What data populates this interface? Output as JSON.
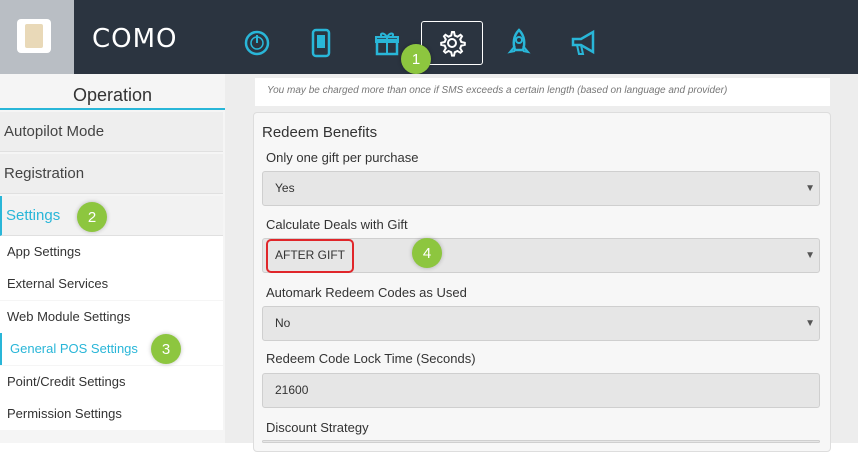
{
  "brand": "COMO",
  "nav": {
    "icons": [
      "dashboard-gauge-icon",
      "mobile-app-icon",
      "gift-icon",
      "gear-icon",
      "rocket-icon",
      "megaphone-icon"
    ],
    "active": "gear-icon"
  },
  "badges": {
    "b1": "1",
    "b2": "2",
    "b3": "3",
    "b4": "4"
  },
  "sidebar": {
    "header": "Operation",
    "main_items": [
      "Autopilot Mode",
      "Registration",
      "Settings"
    ],
    "sub_items": [
      "App Settings",
      "External Services",
      "Web Module Settings",
      "General POS Settings",
      "Point/Credit Settings",
      "Permission Settings"
    ]
  },
  "content": {
    "sms_note": "You may be charged more than once if SMS exceeds a certain length (based on language and provider)",
    "panel_title": "Redeem Benefits",
    "fields": [
      {
        "label": "Only one gift per purchase",
        "value": "Yes"
      },
      {
        "label": "Calculate Deals with Gift",
        "value": "AFTER GIFT"
      },
      {
        "label": "Automark Redeem Codes as Used",
        "value": "No"
      },
      {
        "label": "Redeem Code Lock Time (Seconds)",
        "value": "21600"
      },
      {
        "label": "Discount Strategy",
        "value": ""
      }
    ]
  },
  "colors": {
    "topbar": "#2b3440",
    "accent": "#29b6d8",
    "badge": "#8dc63f",
    "highlight": "#e0262a"
  }
}
